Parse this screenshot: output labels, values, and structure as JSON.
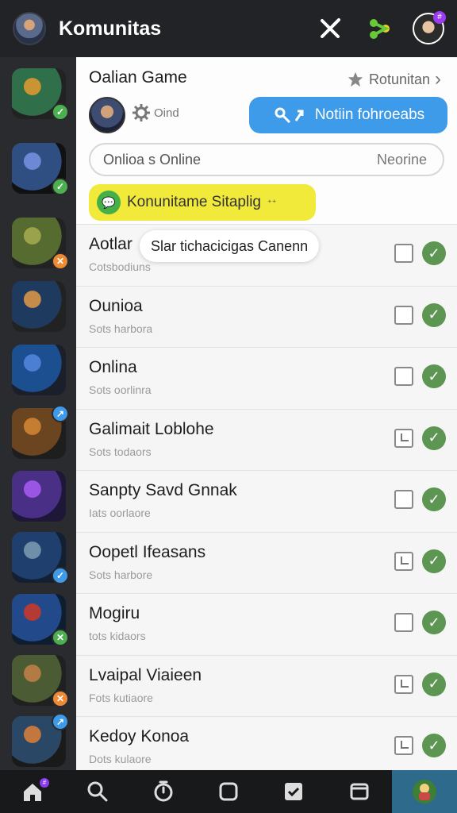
{
  "topbar": {
    "title": "Komunitas",
    "icons": [
      "avatar",
      "close-icon",
      "share-icon",
      "profile-avatar"
    ],
    "profile_badge": "#"
  },
  "sidebar": {
    "items": [
      {
        "name": "game-1",
        "badge": "✓",
        "badge_color": "#4caf50",
        "colors": [
          "#2f6f49",
          "#c89434",
          "#222"
        ]
      },
      {
        "name": "game-2",
        "badge": "✓",
        "badge_color": "#4caf50",
        "colors": [
          "#2f4f83",
          "#6d89d5",
          "#111"
        ]
      },
      {
        "name": "game-3",
        "badge": "✕",
        "badge_color": "#f08a32",
        "colors": [
          "#556b2f",
          "#9aa34b",
          "#222"
        ]
      },
      {
        "name": "game-4",
        "badge": "",
        "badge_color": "",
        "colors": [
          "#1f3a5f",
          "#c58b4a",
          "#222"
        ]
      },
      {
        "name": "game-5",
        "badge": "",
        "badge_color": "",
        "colors": [
          "#1b4f8f",
          "#4b7fd4",
          "#1b1f2b"
        ]
      },
      {
        "name": "game-6",
        "badge": "↗",
        "badge_color": "#3d9be9",
        "colors": [
          "#6b4520",
          "#c47d31",
          "#1e1e1e"
        ]
      },
      {
        "name": "game-7",
        "badge": "",
        "badge_color": "",
        "colors": [
          "#4a2f86",
          "#9b55e4",
          "#1e1738"
        ]
      },
      {
        "name": "game-8",
        "badge": "✓",
        "badge_color": "#3d9be9",
        "colors": [
          "#1f3f6e",
          "#6f8fa9",
          "#132032"
        ]
      },
      {
        "name": "game-9",
        "badge": "✕",
        "badge_color": "#4caf50",
        "colors": [
          "#224a8a",
          "#b43a36",
          "#0f1d30"
        ]
      },
      {
        "name": "game-10",
        "badge": "✕",
        "badge_color": "#f08a32",
        "colors": [
          "#4b5b33",
          "#b37b44",
          "#202020"
        ]
      },
      {
        "name": "game-11",
        "badge": "↗",
        "badge_color": "#3d9be9",
        "colors": [
          "#2a4766",
          "#c1773d",
          "#1a1a1a"
        ]
      }
    ]
  },
  "header": {
    "game_title": "Oalian Game",
    "rank_label": "Rotunitan",
    "gear_status": "Oind",
    "notif_button": "Notiin fohroeabs",
    "search_left": "Onlioa s Online",
    "search_right": "Neorine",
    "promo_label": "Konunitame Sitaplig",
    "promo_tail": "⁺⁺"
  },
  "tooltip": {
    "text": "Slar tichacicigas Canenn"
  },
  "rows": [
    {
      "title": "Aotlar",
      "subtitle": "Cotsbodiuns",
      "checkbox": "empty",
      "status": "ok"
    },
    {
      "title": "Ounioa",
      "subtitle": "Sots harbora",
      "checkbox": "empty",
      "status": "ok"
    },
    {
      "title": "Onlina",
      "subtitle": "Sots oorlinra",
      "checkbox": "empty",
      "status": "ok"
    },
    {
      "title": "Galimait Loblohe",
      "subtitle": "Sots todaors",
      "checkbox": "flag",
      "status": "ok"
    },
    {
      "title": "Sanpty Savd Gnnak",
      "subtitle": "Iats oorlaore",
      "checkbox": "empty",
      "status": "ok"
    },
    {
      "title": "Oopetl Ifeasans",
      "subtitle": "Sots harbore",
      "checkbox": "flag",
      "status": "ok"
    },
    {
      "title": "Mogiru",
      "subtitle": "tots kidaors",
      "checkbox": "empty",
      "status": "ok"
    },
    {
      "title": "Lvaipal Viaieen",
      "subtitle": "Fots kutiaore",
      "checkbox": "flag",
      "status": "ok"
    },
    {
      "title": "Kedoy Konoa",
      "subtitle": "Dots kulaore",
      "checkbox": "flag",
      "status": "ok"
    }
  ],
  "bottombar": {
    "tabs": [
      "home-icon",
      "search-icon",
      "timer-icon",
      "square-icon",
      "check-square-icon",
      "window-icon",
      "game-avatar"
    ],
    "home_badge": "#"
  }
}
